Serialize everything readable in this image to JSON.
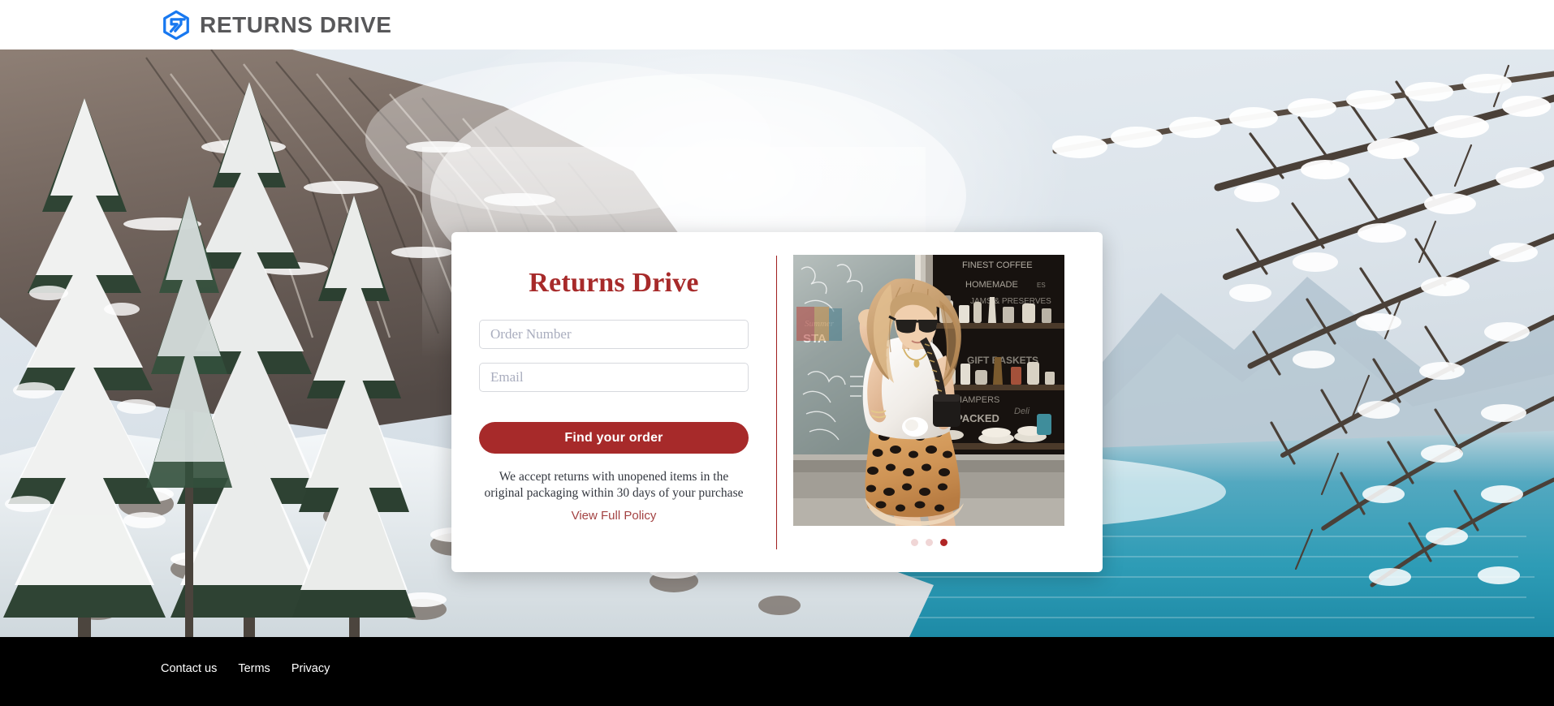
{
  "header": {
    "brand_name": "RETURNS DRIVE",
    "logo_icon": "returns-drive-hexagon-logo",
    "logo_color": "#1878f0",
    "brand_text_color": "#58585a",
    "background": "#ffffff"
  },
  "hero": {
    "scene": "snow-covered evergreen forest and turquoise mountain lake",
    "sky_color": "#dfe6ec",
    "water_color": "#2f9fb8"
  },
  "card": {
    "title": "Returns Drive",
    "accent_color": "#a72a2a",
    "divider_color": "#a02020",
    "order_number_field": {
      "placeholder": "Order Number",
      "value": ""
    },
    "email_field": {
      "placeholder": "Email",
      "value": ""
    },
    "submit_label": "Find your order",
    "policy_note": "We accept returns with unopened items in the original packaging within 30 days of your purchase",
    "policy_link_label": "View Full Policy",
    "carousel": {
      "image_alt": "Woman wearing white t-shirt and leopard print skirt in front of a deli storefront",
      "total_slides": 3,
      "active_slide": 3,
      "dot_color": "#f0d6d6",
      "active_dot_color": "#b02525"
    }
  },
  "footer": {
    "background": "#000000",
    "links": [
      {
        "label": "Contact us"
      },
      {
        "label": "Terms"
      },
      {
        "label": "Privacy"
      }
    ]
  }
}
